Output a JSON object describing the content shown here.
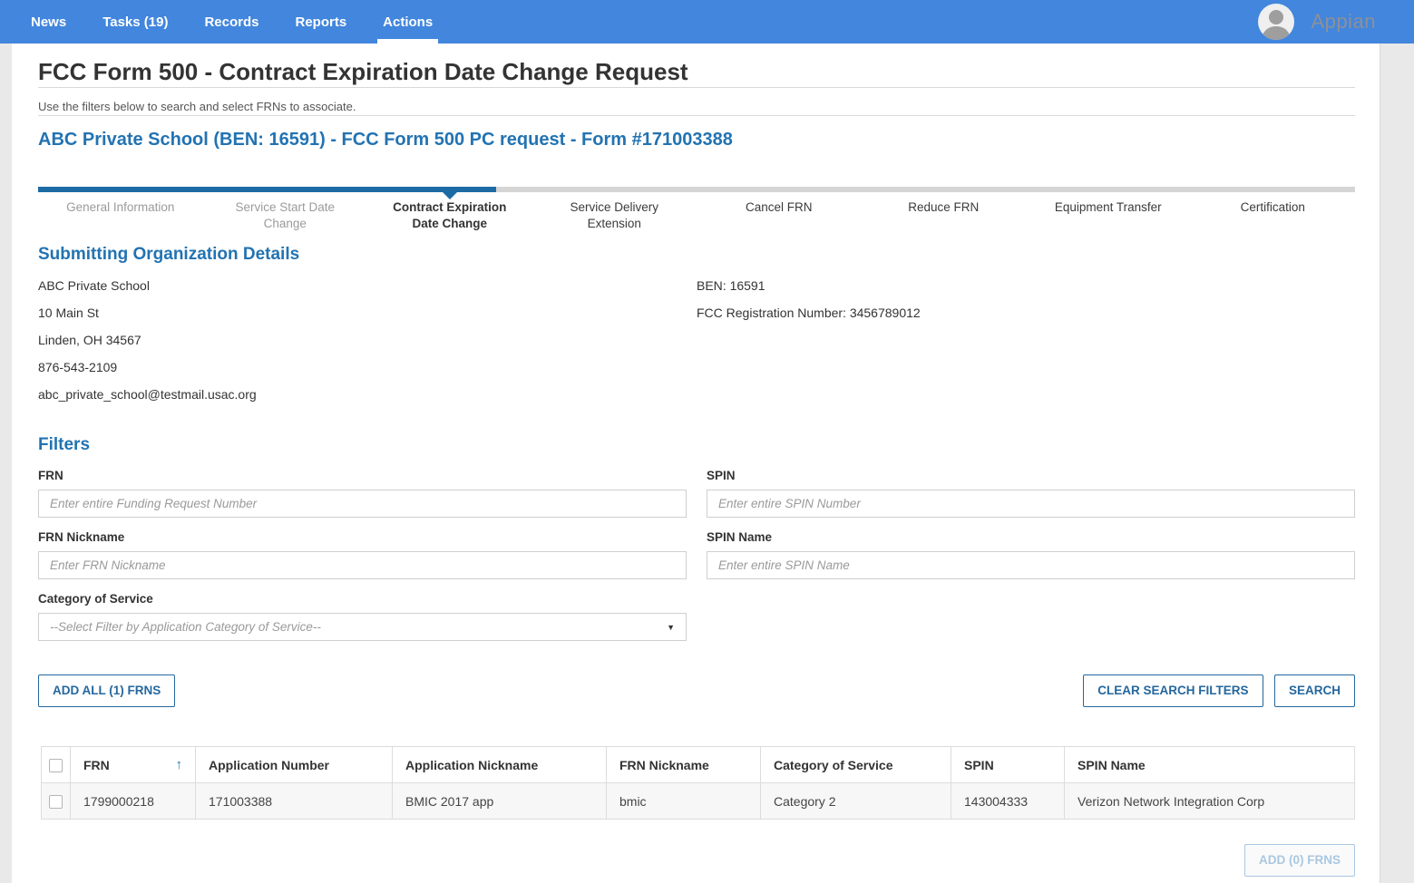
{
  "colors": {
    "header_bg": "#4286dd",
    "accent_blue": "#2273b2",
    "milestone_blue": "#1d6ba4",
    "button_blue": "#24679e",
    "disabled_blue": "#a9c7e2"
  },
  "nav": {
    "items": [
      {
        "label": "News"
      },
      {
        "label": "Tasks (19)"
      },
      {
        "label": "Records"
      },
      {
        "label": "Reports"
      },
      {
        "label": "Actions"
      }
    ],
    "active": "Actions",
    "brand": "Appian"
  },
  "page": {
    "title": "FCC Form 500 - Contract Expiration Date Change Request",
    "subtitle": "Use the filters below to search and select FRNs to associate.",
    "form_heading": "ABC Private School (BEN: 16591) - FCC Form 500 PC request - Form #171003388"
  },
  "wizard": {
    "steps": [
      "General Information",
      "Service Start Date Change",
      "Contract Expiration Date Change",
      "Service Delivery Extension",
      "Cancel FRN",
      "Reduce FRN",
      "Equipment Transfer",
      "Certification"
    ],
    "current_step": "Contract Expiration Date Change"
  },
  "org": {
    "heading": "Submitting Organization Details",
    "name": "ABC Private School",
    "address1": "10 Main St",
    "address2": "Linden, OH 34567",
    "phone": "876-543-2109",
    "email": "abc_private_school@testmail.usac.org",
    "ben": "BEN: 16591",
    "fcc_registration": "FCC Registration Number: 3456789012"
  },
  "filters": {
    "heading": "Filters",
    "frn": {
      "label": "FRN",
      "placeholder": "Enter entire Funding Request Number",
      "value": ""
    },
    "spin": {
      "label": "SPIN",
      "placeholder": "Enter entire SPIN Number",
      "value": ""
    },
    "frn_nickname": {
      "label": "FRN Nickname",
      "placeholder": "Enter FRN Nickname",
      "value": ""
    },
    "spin_name": {
      "label": "SPIN Name",
      "placeholder": "Enter entire SPIN Name",
      "value": ""
    },
    "category_of_service": {
      "label": "Category of Service",
      "selected": "--Select Filter by Application Category of Service--"
    }
  },
  "actions": {
    "add_all": "ADD ALL (1) FRNS",
    "clear_filters": "CLEAR SEARCH FILTERS",
    "search": "SEARCH",
    "add_selected": "ADD (0) FRNS"
  },
  "icons": {
    "dropdown": "▼",
    "sort_asc": "↑"
  },
  "table": {
    "columns": [
      "FRN",
      "Application Number",
      "Application Nickname",
      "FRN Nickname",
      "Category of Service",
      "SPIN",
      "SPIN Name"
    ],
    "sort": {
      "column": "FRN",
      "direction": "ascending"
    },
    "rows": [
      {
        "frn": "1799000218",
        "application_number": "171003388",
        "application_nickname": "BMIC 2017 app",
        "frn_nickname": "bmic",
        "category_of_service": "Category 2",
        "spin": "143004333",
        "spin_name": "Verizon Network Integration Corp"
      }
    ]
  }
}
